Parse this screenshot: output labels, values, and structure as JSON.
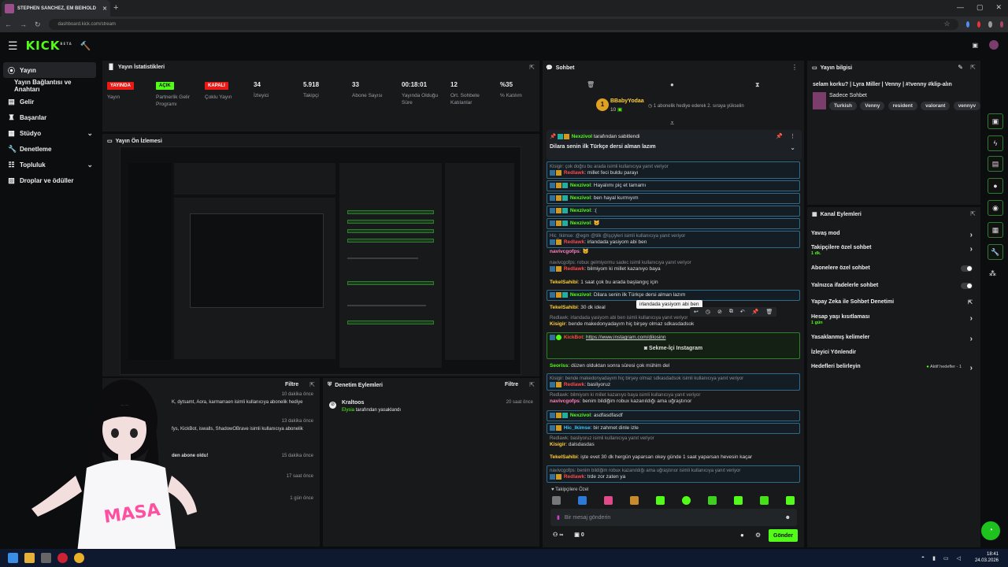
{
  "browser": {
    "tab_title": "STEPHEN SANCHEZ, EM BEIHOLD",
    "new_tab": "+",
    "url": "dashboard.kick.com/stream",
    "window_controls": [
      "—",
      "▢",
      "✕"
    ]
  },
  "app": {
    "logo": "KICK",
    "logo_sup": "BETA"
  },
  "sidebar": {
    "items": [
      {
        "label": "Yayın",
        "icon": "broadcast-icon",
        "active": true
      },
      {
        "label": "Yayın Bağlantısı ve Anahtarı",
        "icon": "",
        "active": false
      },
      {
        "label": "Gelir",
        "icon": "money-icon"
      },
      {
        "label": "Başarılar",
        "icon": "trophy-icon"
      },
      {
        "label": "Stüdyo",
        "icon": "studio-icon",
        "chevron": true
      },
      {
        "label": "Denetleme",
        "icon": "wrench-icon"
      },
      {
        "label": "Topluluk",
        "icon": "community-icon",
        "chevron": true
      },
      {
        "label": "Droplar ve ödüller",
        "icon": "gift-icon"
      }
    ]
  },
  "stats": {
    "title": "Yayın İstatistikleri",
    "items": [
      {
        "pill": "YAYINDA",
        "label": "Yayın",
        "pill_color": "#e91916"
      },
      {
        "pill": "AÇIK",
        "label": "Partnerlik Gelir Programı",
        "pill_color": "#53fc18"
      },
      {
        "pill": "KAPALI",
        "label": "Çoklu Yayın",
        "pill_color": "#e91916"
      },
      {
        "value": "34",
        "label": "İzleyici"
      },
      {
        "value": "5.918",
        "label": "Takipçi"
      },
      {
        "value": "33",
        "label": "Abone Sayısı"
      },
      {
        "value": "00:18:01",
        "label": "Yayında Olduğu Süre"
      },
      {
        "value": "12",
        "label": "Ort. Sohbete Katılanlar"
      },
      {
        "value": "%35",
        "label": "% Katılım"
      }
    ]
  },
  "preview": {
    "title": "Yayın Ön İzlemesi"
  },
  "activity": {
    "filter": "Filtre",
    "rows": [
      {
        "text": "K, dytsamt, Aora, karmarraen isimli kullanıcıya abonelik hediye",
        "time": "10 dakika önce"
      },
      {
        "text": "fys, KickBot, iswalls, ShadowOBrave isimli kullanıcıya abonelik",
        "time": "13 dakika önce"
      },
      {
        "text": "den abone oldu!",
        "time": "15 dakika önce"
      },
      {
        "text": "",
        "time": "17 saat önce"
      },
      {
        "text": "",
        "time": "1 gün önce"
      }
    ]
  },
  "moderation": {
    "title": "Denetim Eylemleri",
    "filter": "Filtre",
    "entry_user": "Kraltoos",
    "entry_actor": "Elysia",
    "entry_action": "tarafından yasaklandı",
    "entry_time": "20 saat önce"
  },
  "chat": {
    "title": "Sohbet",
    "gift_user": "BBabyYodaa",
    "gift_count": "10",
    "gift_text": "1 abonelik hediye ederek 2. sıraya yükselin",
    "pinned_by": "Nexzivol",
    "pinned_by_suffix": "tarafından sabitlendi",
    "pinned_text": "Dilara senin ilk Türkçe dersi alman lazım",
    "messages": [
      {
        "reply": "Kisigir: çok doğru bu arada isimli kullanıcıya yanıt veriyor",
        "user": "Redlawk",
        "color": "nred",
        "text": "millet feci buldu parayı",
        "boxed": true
      },
      {
        "user": "Nexzivol",
        "color": "ngr",
        "text": "Hayalımı piç et tamamı",
        "boxed": true
      },
      {
        "user": "Nexzivol",
        "color": "ngr",
        "text": "ben hayal kurmıyım",
        "boxed": true
      },
      {
        "user": "Nexzivol",
        "color": "ngr",
        "text": ":(",
        "boxed": true
      },
      {
        "user": "Nexzivol",
        "color": "ngr",
        "text": "🐱",
        "boxed": true
      },
      {
        "reply": "Hic_Ikimse: @egm @tilk @işçiyleri isimli kullanıcıya yanıt veriyor",
        "user": "Redlawk",
        "color": "nred",
        "text": "irlandada yasiyom abi ben",
        "boxed": true
      },
      {
        "user": "navivcgofps",
        "color": "npink",
        "text": "🐱",
        "boxed": false
      },
      {
        "reply": "navivcgofps: robux gelmiyormu sadec isimli kullanıcıya yanıt veriyor",
        "user": "Redlawk",
        "color": "nred",
        "text": "bilmiyom ki millet kazanıyo baya",
        "boxed": true
      },
      {
        "user": "TekelSahibi",
        "color": "nyel",
        "text": "1 saat çok bu arada başlangıç için",
        "boxed": false
      },
      {
        "user": "Nexzivol",
        "color": "ngr",
        "text": "Dilara senin ilk Türkçe dersi alman lazım",
        "boxed": true
      },
      {
        "user": "TekelSahibi",
        "color": "nyel",
        "text": "30 dk ideal",
        "boxed": false
      },
      {
        "reply": "Redlawk: irlandada yasiyom abi ben isimli kullanıcıya yanıt veriyor",
        "user": "Kisigir",
        "color": "nyel",
        "text": "bende makedonyadayım hiç birşey olmaz sdkasdadsok",
        "boxed": false
      },
      {
        "user": "KickBot",
        "color": "nred",
        "text": "https://www.instagram.com/dilosinn",
        "link": true,
        "button": "Sekme-İçi Instagram",
        "boxed": "green"
      },
      {
        "user": "Seoriss",
        "color": "ngr",
        "text": "düzen olduktan sonra süresi çok mühim del",
        "boxed": false
      },
      {
        "reply": "Kisigir: bende makedonyadayım hiç birşey olmaz sdkasdadsok isimli kullanıcıya yanıt veriyor",
        "user": "Redlawk",
        "color": "nred",
        "text": "basliyoruz",
        "boxed": true
      },
      {
        "reply": "Redlawk: bilmiyom ki millet kazanıyo baya isimli kullanıcıya yanıt veriyor",
        "user": "navivcgofps",
        "color": "npink",
        "text": "benim bildiğim robux kazanıldığı ama uğraştırıor",
        "boxed": false
      },
      {
        "user": "Nexzivol",
        "color": "ngr",
        "text": "asdfasdfasdf",
        "boxed": true
      },
      {
        "user": "Hic_Ikimse",
        "color": "ncyan",
        "text": "bir zahmet dinle izle",
        "boxed": true
      },
      {
        "reply": "Redlawk: basliyoruz isimli kullanıcıya yanıt veriyor",
        "user": "Kisigir",
        "color": "nyel",
        "text": "dalsdasdas",
        "boxed": false
      },
      {
        "user": "TekelSahibi",
        "color": "nyel",
        "text": "işte evet 30 dk hergün yaparsan okey günde 1 saat yaparsan hevesin kaçar",
        "boxed": false
      },
      {
        "reply": "navivcgofps: benim bildiğim robux kazanıldığı ama uğraştırıor isimli kullanıcıya yanıt veriyor",
        "user": "Redlawk",
        "color": "nred",
        "text": "trde zor zaten ya",
        "boxed": true
      }
    ],
    "tooltip": "irlandada yasiyom abi ben",
    "followers_only": "Takipçilere Özel",
    "input_placeholder": "Bir mesaj gönderin",
    "send": "Gönder",
    "counter_a": "∞",
    "counter_b": "0"
  },
  "stream_info": {
    "title": "Yayın bilgisi",
    "stream_title": "selam korku? | Lyra Miller | Venny | #!venny #klip-alın",
    "mode": "Sadece Sohbet",
    "tags": [
      "Turkish",
      "Venny",
      "resident",
      "valorant",
      "vennyv"
    ]
  },
  "channel_actions": {
    "title": "Kanal Eylemleri",
    "items": [
      {
        "label": "Yavaş mod",
        "control": "arrow"
      },
      {
        "label": "Takipçilere özel sohbet",
        "sub": "1 dk.",
        "control": "arrow"
      },
      {
        "label": "Abonelere özel sohbet",
        "control": "toggle"
      },
      {
        "label": "Yalnızca ifadelerle sohbet",
        "control": "toggle"
      },
      {
        "label": "Yapay Zeka ile Sohbet Denetimi",
        "control": "ext"
      },
      {
        "label": "Hesap yaşı kısıtlaması",
        "sub": "1 gün",
        "control": "arrow"
      },
      {
        "label": "Yasaklanmış kelimeler",
        "control": "arrow"
      },
      {
        "label": "İzleyici Yönlendir",
        "control": "none"
      },
      {
        "label": "Hedefleri belirleyin",
        "right_text": "Aktif hedefler - 1",
        "control": "arrow"
      }
    ]
  },
  "taskbar": {
    "time": "18:41",
    "date": "24.03.2026"
  }
}
